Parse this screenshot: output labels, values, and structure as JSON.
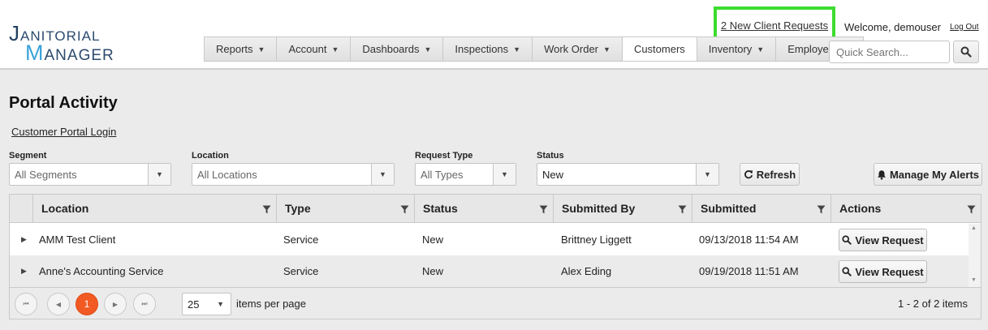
{
  "header": {
    "logo_line1_initial": "J",
    "logo_line1_rest": "ANITORIAL",
    "logo_line2_initial": "M",
    "logo_line2_rest": "ANAGER",
    "new_requests": "2 New Client Requests",
    "welcome": "Welcome, demouser",
    "logout": "Log Out",
    "search_placeholder": "Quick Search...",
    "nav": [
      "Reports",
      "Account",
      "Dashboards",
      "Inspections",
      "Work Order",
      "Customers",
      "Inventory",
      "Employees"
    ],
    "active_nav": "Customers",
    "highlight_color": "#3ddc2f"
  },
  "page": {
    "title": "Portal Activity",
    "portal_link": "Customer Portal Login"
  },
  "filters": {
    "segment": {
      "label": "Segment",
      "value": "All Segments"
    },
    "location": {
      "label": "Location",
      "value": "All Locations"
    },
    "request_type": {
      "label": "Request Type",
      "value": "All Types"
    },
    "status": {
      "label": "Status",
      "value": "New"
    },
    "refresh_label": "Refresh",
    "alerts_label": "Manage My Alerts"
  },
  "grid": {
    "columns": [
      "Location",
      "Type",
      "Status",
      "Submitted By",
      "Submitted",
      "Actions"
    ],
    "rows": [
      {
        "location": "AMM Test Client",
        "type": "Service",
        "status": "New",
        "submitted_by": "Brittney Liggett",
        "submitted": "09/13/2018 11:54 AM",
        "action": "View Request"
      },
      {
        "location": "Anne's Accounting Service",
        "type": "Service",
        "status": "New",
        "submitted_by": "Alex Eding",
        "submitted": "09/19/2018 11:51 AM",
        "action": "View Request"
      }
    ]
  },
  "pager": {
    "current_page": "1",
    "page_size": "25",
    "items_per_page_label": "items per page",
    "item_count": "1 - 2 of 2 items",
    "current_color": "#f15a22"
  }
}
